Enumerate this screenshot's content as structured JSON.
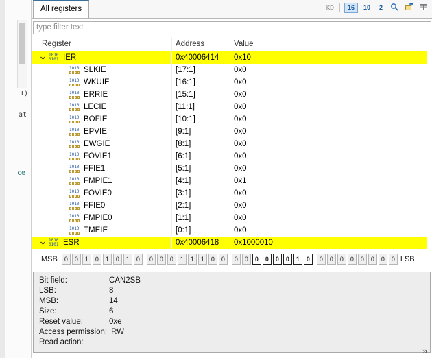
{
  "tab": {
    "label": "All registers"
  },
  "toolbar": {
    "kd_label": "KD",
    "radix": [
      {
        "label": "16",
        "active": true
      },
      {
        "label": "10",
        "active": false
      },
      {
        "label": "2",
        "active": false
      }
    ]
  },
  "filter": {
    "placeholder": "type filter text"
  },
  "table": {
    "columns": [
      "Register",
      "Address",
      "Value"
    ],
    "rows": [
      {
        "type": "register",
        "name": "IER",
        "address": "0x40006414",
        "value": "0x10",
        "selected": true,
        "expanded": true
      },
      {
        "type": "field",
        "name": "SLKIE",
        "address": "[17:1]",
        "value": "0x0"
      },
      {
        "type": "field",
        "name": "WKUIE",
        "address": "[16:1]",
        "value": "0x0"
      },
      {
        "type": "field",
        "name": "ERRIE",
        "address": "[15:1]",
        "value": "0x0"
      },
      {
        "type": "field",
        "name": "LECIE",
        "address": "[11:1]",
        "value": "0x0"
      },
      {
        "type": "field",
        "name": "BOFIE",
        "address": "[10:1]",
        "value": "0x0"
      },
      {
        "type": "field",
        "name": "EPVIE",
        "address": "[9:1]",
        "value": "0x0"
      },
      {
        "type": "field",
        "name": "EWGIE",
        "address": "[8:1]",
        "value": "0x0"
      },
      {
        "type": "field",
        "name": "FOVIE1",
        "address": "[6:1]",
        "value": "0x0"
      },
      {
        "type": "field",
        "name": "FFIE1",
        "address": "[5:1]",
        "value": "0x0"
      },
      {
        "type": "field",
        "name": "FMPIE1",
        "address": "[4:1]",
        "value": "0x1"
      },
      {
        "type": "field",
        "name": "FOVIE0",
        "address": "[3:1]",
        "value": "0x0"
      },
      {
        "type": "field",
        "name": "FFIE0",
        "address": "[2:1]",
        "value": "0x0"
      },
      {
        "type": "field",
        "name": "FMPIE0",
        "address": "[1:1]",
        "value": "0x0"
      },
      {
        "type": "field",
        "name": "TMEIE",
        "address": "[0:1]",
        "value": "0x0"
      },
      {
        "type": "register",
        "name": "ESR",
        "address": "0x40006418",
        "value": "0x1000010",
        "selected": true,
        "expanded": true
      }
    ]
  },
  "bits": {
    "msb_label": "MSB",
    "lsb_label": "LSB",
    "cells": [
      0,
      0,
      1,
      0,
      1,
      0,
      1,
      0,
      0,
      0,
      0,
      1,
      1,
      1,
      0,
      0,
      0,
      0,
      0,
      0,
      0,
      0,
      1,
      0,
      0,
      0,
      0,
      0,
      0,
      0,
      0,
      0
    ],
    "selected_msb": 13,
    "selected_lsb": 8
  },
  "properties": {
    "rows": [
      {
        "label": "Bit field:",
        "value": "CAN2SB"
      },
      {
        "label": "LSB:",
        "value": "8"
      },
      {
        "label": "MSB:",
        "value": "14"
      },
      {
        "label": "Size:",
        "value": "6"
      },
      {
        "label": "Reset value:",
        "value": "0xe"
      },
      {
        "label": "Access permission:",
        "value": "RW"
      },
      {
        "label": "Read action:",
        "value": ""
      }
    ]
  },
  "left_strip": {
    "fragments": [
      "1)",
      "at",
      "ce"
    ]
  },
  "misc": {
    "overflow_chevron": "»"
  }
}
